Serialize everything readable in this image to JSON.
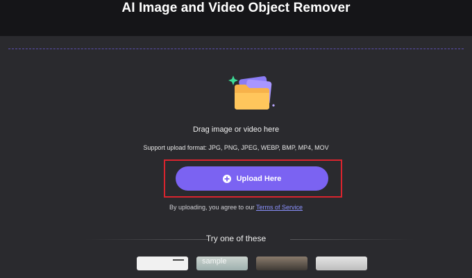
{
  "header": {
    "title": "AI Image and Video Object Remover"
  },
  "upload": {
    "drag_text": "Drag image or video here",
    "formats": "Support upload format: JPG, PNG, JPEG, WEBP, BMP, MP4, MOV",
    "button_label": "Upload Here",
    "terms_prefix": "By uploading, you agree to our ",
    "terms_link": "Terms of Service"
  },
  "samples": {
    "heading": "Try one of these",
    "watermark": "sample"
  },
  "colors": {
    "accent": "#7b63f2",
    "highlight": "#d9242e",
    "background": "#2a2a2e",
    "topbar": "#151518"
  }
}
